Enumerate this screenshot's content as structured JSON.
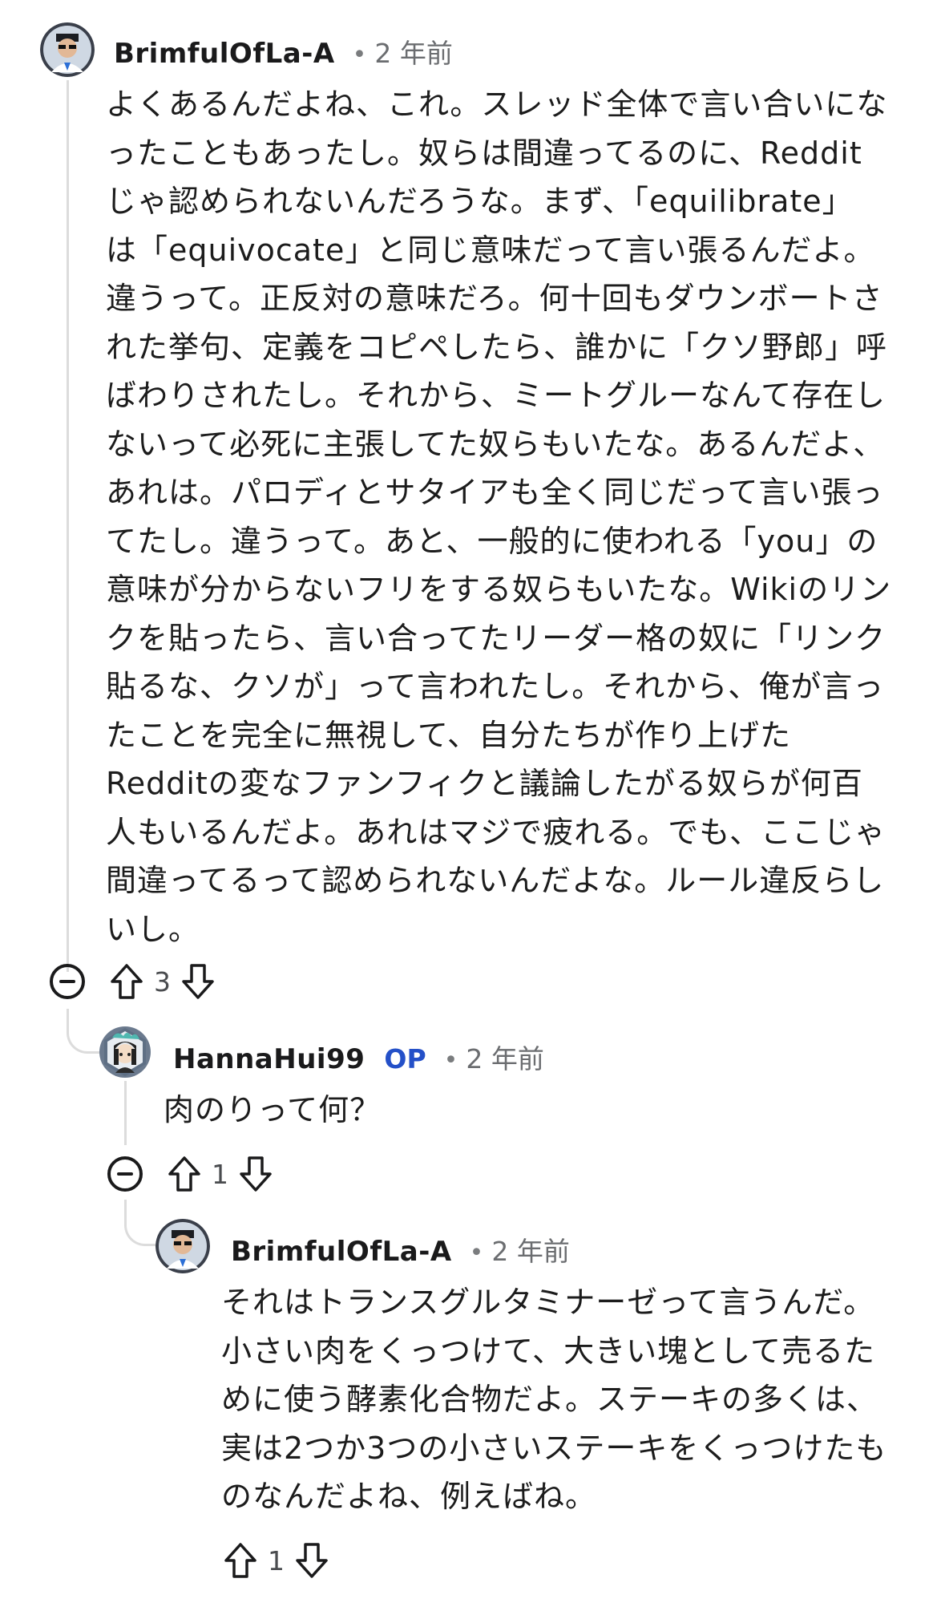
{
  "comments": [
    {
      "username": "BrimfulOfLa-A",
      "time": "2 年前",
      "lines": [
        "よくあるんだよね、これ。スレッド全体で言い合いにな",
        "ったこともあったし。奴らは間違ってるのに、Reddit",
        "じゃ認められないんだろうな。まず、「equilibrate」",
        "は「equivocate」と同じ意味だって言い張るんだよ。",
        "違うって。正反対の意味だろ。何十回もダウンボートさ",
        "れた挙句、定義をコピペしたら、誰かに「クソ野郎」呼",
        "ばわりされたし。それから、ミートグルーなんて存在し",
        "ないって必死に主張してた奴らもいたな。あるんだよ、",
        "あれは。パロディとサタイアも全く同じだって言い張っ",
        "てたし。違うって。あと、一般的に使われる「you」の",
        "意味が分からないフリをする奴らもいたな。Wikiのリン",
        "クを貼ったら、言い合ってたリーダー格の奴に「リンク",
        "貼るな、クソが」って言われたし。それから、俺が言っ",
        "たことを完全に無視して、自分たちが作り上げた",
        "Redditの変なファンフィクと議論したがる奴らが何百",
        "人もいるんだよ。あれはマジで疲れる。でも、ここじゃ",
        "間違ってるって認められないんだよな。ルール違反らし",
        "いし。"
      ],
      "score": "3"
    },
    {
      "username": "HannaHui99",
      "op_badge": "OP",
      "time": "2 年前",
      "lines": [
        "肉のりって何？"
      ],
      "score": "1"
    },
    {
      "username": "BrimfulOfLa-A",
      "time": "2 年前",
      "lines": [
        "それはトランスグルタミナーゼって言うんだ。",
        "小さい肉をくっつけて、大きい塊として売るた",
        "めに使う酵素化合物だよ。ステーキの多くは、",
        "実は2つか3つの小さいステーキをくっつけたも",
        "のなんだよね、例えばね。"
      ],
      "score": "1"
    }
  ],
  "separator": "•",
  "colors": {
    "op": "#2450c8",
    "thread": "#dcdcdc",
    "meta": "#6b6d70"
  },
  "icons": [
    "avatar-icon",
    "collapse-icon",
    "upvote-icon",
    "downvote-icon"
  ]
}
